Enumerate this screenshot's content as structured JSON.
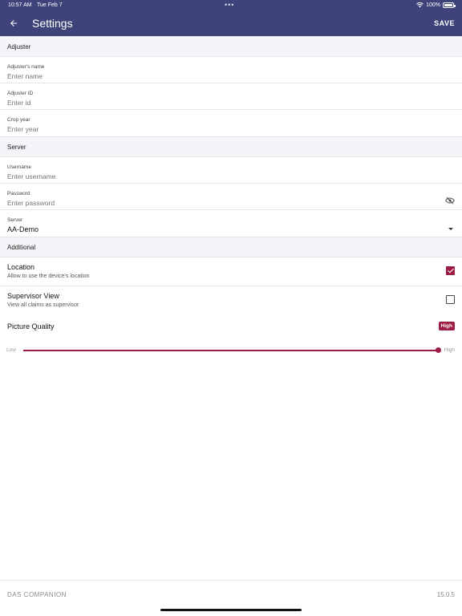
{
  "status_bar": {
    "time": "10:57 AM",
    "date": "Tue Feb 7",
    "battery": "100%"
  },
  "header": {
    "title": "Settings",
    "save_label": "SAVE",
    "back_icon": "arrow-back-icon"
  },
  "sections": {
    "adjuster": "Adjuster",
    "server": "Server",
    "additional": "Additional"
  },
  "fields": {
    "adjuster_name": {
      "label": "Adjuster's name",
      "placeholder": "Enter name",
      "value": ""
    },
    "adjuster_id": {
      "label": "Adjuster ID",
      "placeholder": "Enter id",
      "value": ""
    },
    "crop_year": {
      "label": "Crop year",
      "placeholder": "Enter year",
      "value": ""
    },
    "username": {
      "label": "Username",
      "placeholder": "Enter username",
      "value": ""
    },
    "password": {
      "label": "Password",
      "placeholder": "Enter password",
      "value": ""
    },
    "server": {
      "label": "Server",
      "value": "AA-Demo"
    }
  },
  "toggles": {
    "location": {
      "title": "Location",
      "subtitle": "Allow to use the device's location",
      "checked": true
    },
    "supervisor": {
      "title": "Supervisor View",
      "subtitle": "View all claims as supervisor",
      "checked": false
    }
  },
  "picture_quality": {
    "label": "Picture Quality",
    "badge": "High",
    "low_label": "Low",
    "high_label": "High",
    "level": 1.0
  },
  "footer": {
    "brand": "DAS COMPANION",
    "version": "15.0.5"
  },
  "colors": {
    "header_bg": "#3e4479",
    "accent": "#9e1c43"
  }
}
